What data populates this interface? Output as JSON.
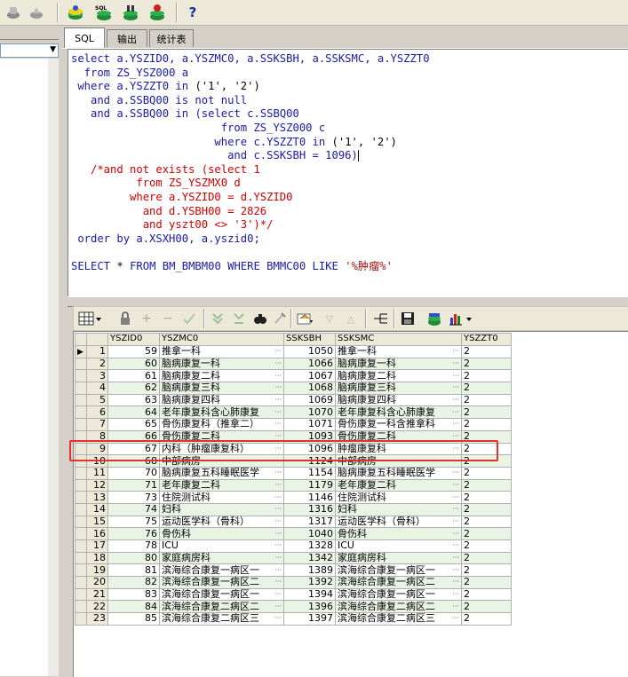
{
  "tabs": [
    {
      "label": "SQL"
    },
    {
      "label": "输出"
    },
    {
      "label": "统计表"
    }
  ],
  "help_label": "?",
  "sql_lines": [
    {
      "parts": [
        {
          "t": "select ",
          "c": "kw"
        },
        {
          "t": "a.YSZID0, a.YSZMC0, a.SSKSBH, a.SSKSMC, a.YSZZT0",
          "c": "kw"
        }
      ]
    },
    {
      "parts": [
        {
          "t": "  from ",
          "c": "kw"
        },
        {
          "t": "ZS_YSZ000 a",
          "c": "kw"
        }
      ]
    },
    {
      "parts": [
        {
          "t": " where ",
          "c": "kw"
        },
        {
          "t": "a.YSZZT0 ",
          "c": "kw"
        },
        {
          "t": "in ",
          "c": "kw"
        },
        {
          "t": "('1', '2')",
          "c": "txt"
        }
      ]
    },
    {
      "parts": [
        {
          "t": "   and ",
          "c": "kw"
        },
        {
          "t": "a.SSBQ00 ",
          "c": "kw"
        },
        {
          "t": "is not null",
          "c": "kw"
        }
      ]
    },
    {
      "parts": [
        {
          "t": "   and ",
          "c": "kw"
        },
        {
          "t": "a.SSBQ00 ",
          "c": "kw"
        },
        {
          "t": "in ",
          "c": "kw"
        },
        {
          "t": "(select ",
          "c": "kw"
        },
        {
          "t": "c.SSBQ00",
          "c": "kw"
        }
      ]
    },
    {
      "parts": [
        {
          "t": "                       from ",
          "c": "kw"
        },
        {
          "t": "ZS_YSZ000 c",
          "c": "kw"
        }
      ]
    },
    {
      "parts": [
        {
          "t": "                      where ",
          "c": "kw"
        },
        {
          "t": "c.YSZZT0 ",
          "c": "kw"
        },
        {
          "t": "in ",
          "c": "kw"
        },
        {
          "t": "('1', '2')",
          "c": "txt"
        }
      ]
    },
    {
      "parts": [
        {
          "t": "                        and ",
          "c": "kw"
        },
        {
          "t": "c.SSKSBH = 1096)",
          "c": "kw"
        }
      ]
    },
    {
      "parts": [
        {
          "t": "   /*and not exists (select 1",
          "c": "cm"
        }
      ]
    },
    {
      "parts": [
        {
          "t": "          from ZS_YSZMX0 d",
          "c": "cm"
        }
      ]
    },
    {
      "parts": [
        {
          "t": "         where a.YSZID0 = d.YSZID0",
          "c": "cm"
        }
      ]
    },
    {
      "parts": [
        {
          "t": "           and d.YSBH00 = 2826",
          "c": "cm"
        }
      ]
    },
    {
      "parts": [
        {
          "t": "           and yszt00 <> '3')*/",
          "c": "cm"
        }
      ]
    },
    {
      "parts": [
        {
          "t": " order by ",
          "c": "kw"
        },
        {
          "t": "a.XSXH00, a.yszid0;",
          "c": "kw"
        }
      ]
    },
    {
      "parts": [
        {
          "t": "",
          "c": "txt"
        }
      ]
    },
    {
      "parts": [
        {
          "t": "SELECT ",
          "c": "kw"
        },
        {
          "t": "* ",
          "c": "txt"
        },
        {
          "t": "FROM ",
          "c": "kw"
        },
        {
          "t": "BM_BMBM00 ",
          "c": "kw"
        },
        {
          "t": "WHERE ",
          "c": "kw"
        },
        {
          "t": "BMMC00 ",
          "c": "kw"
        },
        {
          "t": "LIKE ",
          "c": "kw"
        },
        {
          "t": "'%肿瘤%'",
          "c": "str"
        }
      ]
    }
  ],
  "grid": {
    "columns": [
      "YSZID0",
      "YSZMC0",
      "SSKSBH",
      "SSKSMC",
      "YSZZT0"
    ],
    "rows": [
      [
        "1",
        "59",
        "推拿一科",
        "1050",
        "推拿一科",
        "2"
      ],
      [
        "2",
        "60",
        "脑病康复一科",
        "1066",
        "脑病康复一科",
        "2"
      ],
      [
        "3",
        "61",
        "脑病康复二科",
        "1067",
        "脑病康复二科",
        "2"
      ],
      [
        "4",
        "62",
        "脑病康复三科",
        "1068",
        "脑病康复三科",
        "2"
      ],
      [
        "5",
        "63",
        "脑病康复四科",
        "1069",
        "脑病康复四科",
        "2"
      ],
      [
        "6",
        "64",
        "老年康复科含心肺康复",
        "1070",
        "老年康复科含心肺康复",
        "2"
      ],
      [
        "7",
        "65",
        "骨伤康复科（推拿二）",
        "1071",
        "骨伤康复一科含推拿科",
        "2"
      ],
      [
        "8",
        "66",
        "骨伤康复二科",
        "1093",
        "骨伤康复二科",
        "2"
      ],
      [
        "9",
        "67",
        "内科（肿瘤康复科）",
        "1096",
        "肿瘤康复科",
        "2"
      ],
      [
        "10",
        "68",
        "中部病房",
        "1124",
        "中部病房",
        "2"
      ],
      [
        "11",
        "70",
        "脑病康复五科睡眠医学",
        "1154",
        "脑病康复五科睡眠医学",
        "2"
      ],
      [
        "12",
        "71",
        "老年康复二科",
        "1179",
        "老年康复二科",
        "2"
      ],
      [
        "13",
        "73",
        "住院测试科",
        "1146",
        "住院测试科",
        "2"
      ],
      [
        "14",
        "74",
        "妇科",
        "1316",
        "妇科",
        "2"
      ],
      [
        "15",
        "75",
        "运动医学科（骨科）",
        "1317",
        "运动医学科（骨科）",
        "2"
      ],
      [
        "16",
        "76",
        "骨伤科",
        "1040",
        "骨伤科",
        "2"
      ],
      [
        "17",
        "78",
        "ICU",
        "1328",
        "ICU",
        "2"
      ],
      [
        "18",
        "80",
        "家庭病房科",
        "1342",
        "家庭病房科",
        "2"
      ],
      [
        "19",
        "81",
        "滨海综合康复一病区一",
        "1389",
        "滨海综合康复一病区一",
        "2"
      ],
      [
        "20",
        "82",
        "滨海综合康复一病区二",
        "1392",
        "滨海综合康复一病区二",
        "2"
      ],
      [
        "21",
        "83",
        "滨海综合康复一病区一",
        "1394",
        "滨海综合康复一病区一",
        "2"
      ],
      [
        "22",
        "84",
        "滨海综合康复二病区二",
        "1396",
        "滨海综合康复二病区二",
        "2"
      ],
      [
        "23",
        "85",
        "滨海综合康复二病区三",
        "1397",
        "滨海综合康复二病区三",
        "2"
      ]
    ],
    "current_row_index": 0,
    "highlighted_row_index": 8
  },
  "colors": {
    "keyword": "#1a1aa6",
    "comment": "#d00000",
    "string": "#a31515",
    "row_alt": "#e9f5e4",
    "highlight": "#e8302a"
  }
}
